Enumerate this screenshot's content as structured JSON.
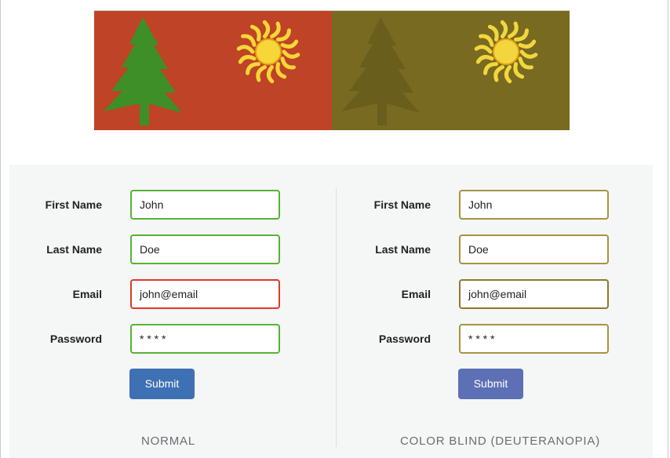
{
  "illustration": {
    "normal": {
      "background": "#bf4326",
      "tree_color": "#3e8f27",
      "sun_color": "#f6d638"
    },
    "deuteranopia": {
      "background": "#786a20",
      "tree_color": "#6a5e1d",
      "sun_color": "#f3d63e"
    }
  },
  "forms": [
    {
      "caption": "NORMAL",
      "fields": [
        {
          "label": "First Name",
          "value": "John",
          "border": "#56b336"
        },
        {
          "label": "Last Name",
          "value": "Doe",
          "border": "#56b336"
        },
        {
          "label": "Email",
          "value": "john@email",
          "border": "#de3a2b"
        },
        {
          "label": "Password",
          "value": "* * * *",
          "border": "#56b336"
        }
      ],
      "submit_label": "Submit",
      "submit_color": "#3e71b3"
    },
    {
      "caption": "COLOR BLIND (DEUTERANOPIA)",
      "fields": [
        {
          "label": "First Name",
          "value": "John",
          "border": "#a59442"
        },
        {
          "label": "Last Name",
          "value": "Doe",
          "border": "#a59442"
        },
        {
          "label": "Email",
          "value": "john@email",
          "border": "#8d7a2c"
        },
        {
          "label": "Password",
          "value": "* * * *",
          "border": "#a59442"
        }
      ],
      "submit_label": "Submit",
      "submit_color": "#5d70b5"
    }
  ]
}
